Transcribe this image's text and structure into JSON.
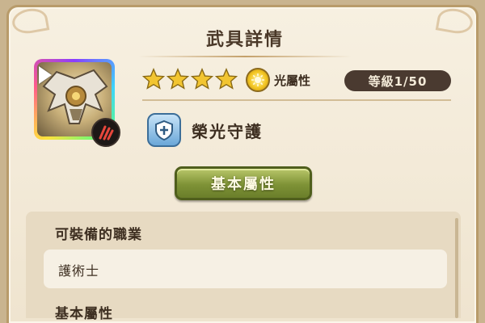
{
  "window": {
    "title": "武具詳情"
  },
  "weapon": {
    "icon": "winged-armor-icon",
    "class_badge_icon": "claw-mark-icon",
    "rarity_stars": 4,
    "element": {
      "icon": "light-element-icon",
      "label": "光屬性"
    },
    "level_label": "等級1/50",
    "level": {
      "current": 1,
      "max": 50
    }
  },
  "skill": {
    "icon": "shield-skill-icon",
    "name": "榮光守護"
  },
  "tabs": {
    "basic_attributes_button": "基本屬性"
  },
  "details": {
    "equippable_classes_title": "可裝備的職業",
    "equippable_classes": [
      "護術士"
    ],
    "basic_attributes_title": "基本屬性"
  },
  "colors": {
    "panel_bg": "#f7f0e1",
    "button_green": "#7e9236",
    "level_badge_bg": "#4a3a30",
    "star_gold": "#f2c531"
  }
}
